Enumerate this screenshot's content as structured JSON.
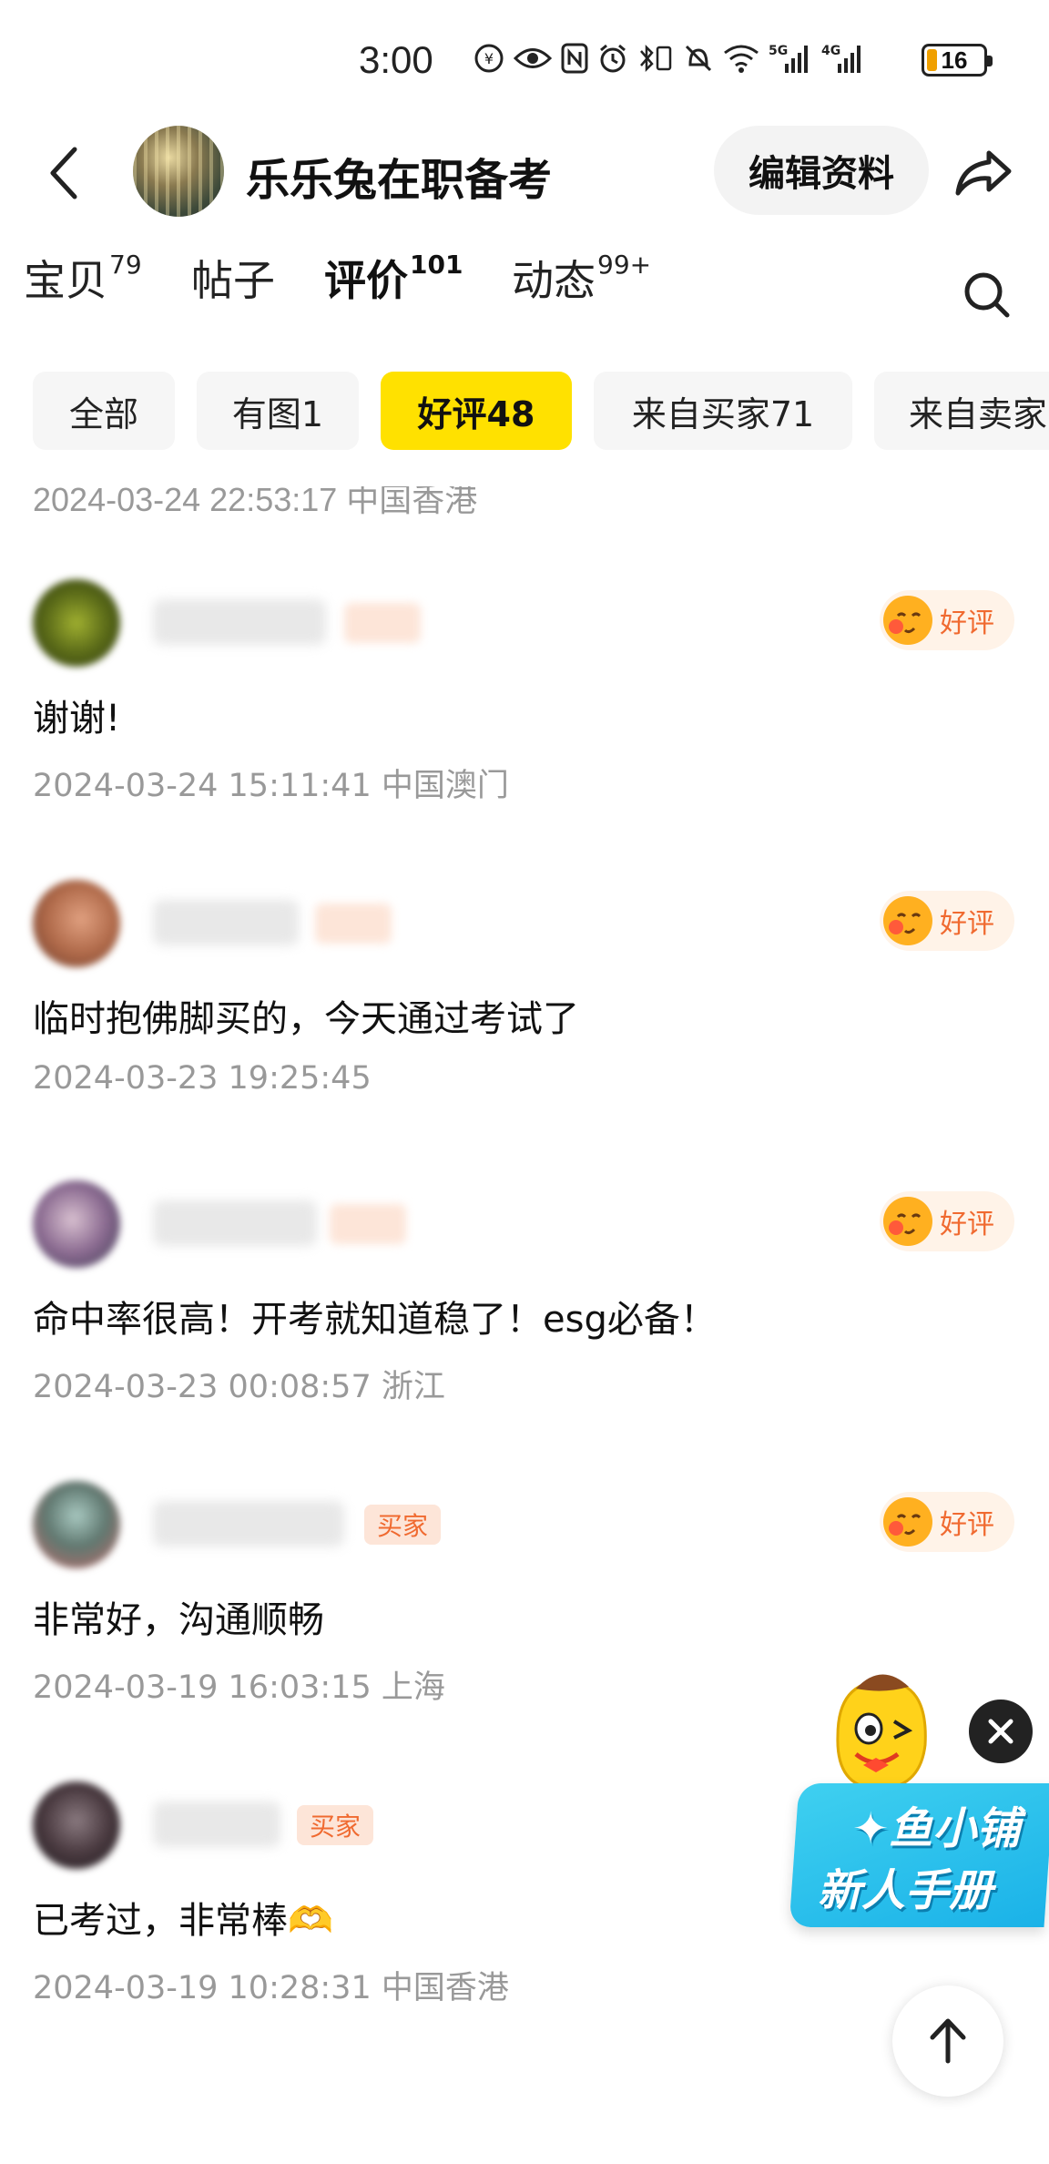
{
  "status_bar": {
    "time": "3:00",
    "icons": [
      "nfc-pay-icon",
      "eye-icon",
      "nfc-icon",
      "alarm-icon",
      "bluetooth-vibrate-icon",
      "mute-icon",
      "wifi-icon",
      "signal-5g-icon",
      "signal-4g-icon"
    ],
    "battery_level": "16"
  },
  "header": {
    "shop_name": "乐乐兔在职备考",
    "edit_label": "编辑资料"
  },
  "tabs": [
    {
      "label": "宝贝",
      "count": "79"
    },
    {
      "label": "帖子",
      "count": ""
    },
    {
      "label": "评价",
      "count": "101",
      "active": true
    },
    {
      "label": "动态",
      "count": "99+"
    }
  ],
  "chips": [
    {
      "label": "全部"
    },
    {
      "label": "有图1"
    },
    {
      "label": "好评48",
      "active": true
    },
    {
      "label": "来自买家71"
    },
    {
      "label": "来自卖家"
    }
  ],
  "prev_review_meta": "2024-03-24 22:53:17 中国香港",
  "reviews": [
    {
      "badge": "",
      "rating": "好评",
      "content": "谢谢!",
      "meta": "2024-03-24 15:11:41 中国澳门"
    },
    {
      "badge": "",
      "rating": "好评",
      "content": "临时抱佛脚买的，今天通过考试了",
      "meta": "2024-03-23 19:25:45"
    },
    {
      "badge": "",
      "rating": "好评",
      "content": "命中率很高！开考就知道稳了！esg必备！",
      "meta": "2024-03-23 00:08:57 浙江"
    },
    {
      "badge": "买家",
      "rating": "好评",
      "content": "非常好，沟通顺畅",
      "meta": "2024-03-19 16:03:15 上海"
    },
    {
      "badge": "买家",
      "rating": "",
      "content": "已考过，非常棒🫶",
      "meta": "2024-03-19 10:28:31 中国香港"
    }
  ],
  "promo": {
    "line1": "✦鱼小铺",
    "line2": "新人手册"
  },
  "colors": {
    "accent_yellow": "#ffe100",
    "rating_orange": "#f06a30",
    "promo_blue": "#1ab2e8"
  }
}
